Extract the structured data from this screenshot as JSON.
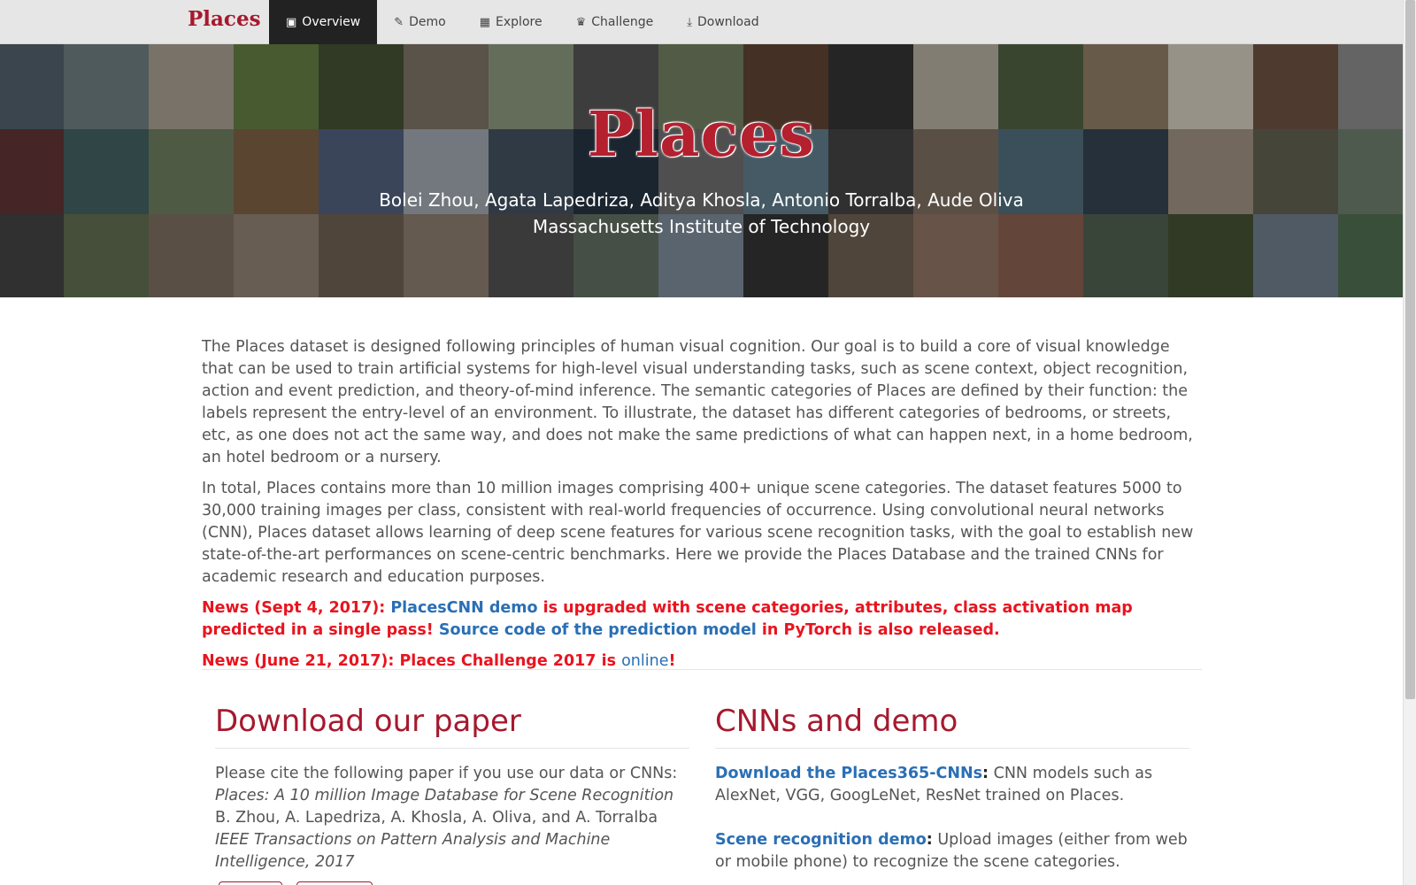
{
  "navbar": {
    "brand": "Places",
    "items": [
      {
        "label": "Overview",
        "icon": "image-icon",
        "glyph": "▣",
        "active": true
      },
      {
        "label": "Demo",
        "icon": "wand-icon",
        "glyph": "✎"
      },
      {
        "label": "Explore",
        "icon": "grid-icon",
        "glyph": "▦"
      },
      {
        "label": "Challenge",
        "icon": "trophy-icon",
        "glyph": "♛"
      },
      {
        "label": "Download",
        "icon": "download-icon",
        "glyph": "⤓"
      }
    ]
  },
  "hero": {
    "title": "Places",
    "authors": "Bolei Zhou, Agata Lapedriza, Aditya Khosla, Antonio Torralba, Aude Oliva",
    "institution": "Massachusetts Institute of Technology",
    "tile_colors": [
      "#5a6b78",
      "#7a8a8f",
      "#b8b0a0",
      "#6f8a4a",
      "#4a5a3a",
      "#8a8070",
      "#9aa88a",
      "#5e5e5e",
      "#7d8c6a",
      "#6a4a3a",
      "#3a3a3a",
      "#c8c0b0",
      "#5a6a4a",
      "#a08a70",
      "#e8e0d0",
      "#7a5a4a",
      "#9a9a9a",
      "#6a3a3a",
      "#4a6a6a",
      "#7a8a6a",
      "#8a6a4a",
      "#5a6a8a",
      "#b0b8c0",
      "#4a5a6a",
      "#2a3a4a",
      "#7a7a7a",
      "#6a8a9a",
      "#4a4a4a",
      "#8a7a6a",
      "#5a7a8a",
      "#3a4a5a",
      "#b0a090",
      "#6a6a5a",
      "#7a8a7a",
      "#4a4a4a",
      "#6a7a5a",
      "#8a7a6a",
      "#a09080",
      "#7a6a5a",
      "#9a8a7a",
      "#5a5a5a",
      "#6a7a6a",
      "#8a9aaa",
      "#3a3a3a",
      "#7a6a5a",
      "#a08070",
      "#9a6a5a",
      "#5a6a5a",
      "#4a5a3a",
      "#7a8a9a",
      "#5a7a5a"
    ]
  },
  "content": {
    "para1": "The Places dataset is designed following principles of human visual cognition. Our goal is to build a core of visual knowledge that can be used to train artificial systems for high-level visual understanding tasks, such as scene context, object recognition, action and event prediction, and theory-of-mind inference. The semantic categories of Places are defined by their function: the labels represent the entry-level of an environment. To illustrate, the dataset has different categories of bedrooms, or streets, etc, as one does not act the same way, and does not make the same predictions of what can happen next, in a home bedroom, an hotel bedroom or a nursery.",
    "para2": "In total, Places contains more than 10 million images comprising 400+ unique scene categories. The dataset features 5000 to 30,000 training images per class, consistent with real-world frequencies of occurrence. Using convolutional neural networks (CNN), Places dataset allows learning of deep scene features for various scene recognition tasks, with the goal to establish new state-of-the-art performances on scene-centric benchmarks. Here we provide the Places Database and the trained CNNs for academic research and education purposes.",
    "news1_prefix": "News (Sept 4, 2017): ",
    "news1_link": "PlacesCNN demo",
    "news1_mid": " is upgraded with scene categories, attributes, class activation map predicted in a single pass! ",
    "news1_link2": "Source code of the prediction model",
    "news1_suffix": " in PyTorch is also released.",
    "news2_prefix": "News (June 21, 2017): Places Challenge 2017 is ",
    "news2_link": "online",
    "news2_suffix": "!"
  },
  "paper": {
    "heading": "Download our paper",
    "cite_intro": "Please cite the following paper if you use our data or CNNs:",
    "title": "Places: A 10 million Image Database for Scene Recognition",
    "authors": "B. Zhou, A. Lapedriza, A. Khosla, A. Oliva, and A. Torralba",
    "venue": "IEEE Transactions on Pattern Analysis and Machine Intelligence, 2017"
  },
  "cnns": {
    "heading": "CNNs and demo",
    "item1_link": "Download the Places365-CNNs",
    "item1_colon": ":",
    "item1_text": " CNN models such as AlexNet, VGG, GoogLeNet, ResNet trained on Places.",
    "item2_link": "Scene recognition demo",
    "item2_colon": ":",
    "item2_text": " Upload images (either from web or mobile phone) to recognize the scene categories."
  },
  "colors": {
    "brand_red": "#a6192e",
    "news_red": "#e8141f",
    "link_blue": "#2a6fb5"
  }
}
